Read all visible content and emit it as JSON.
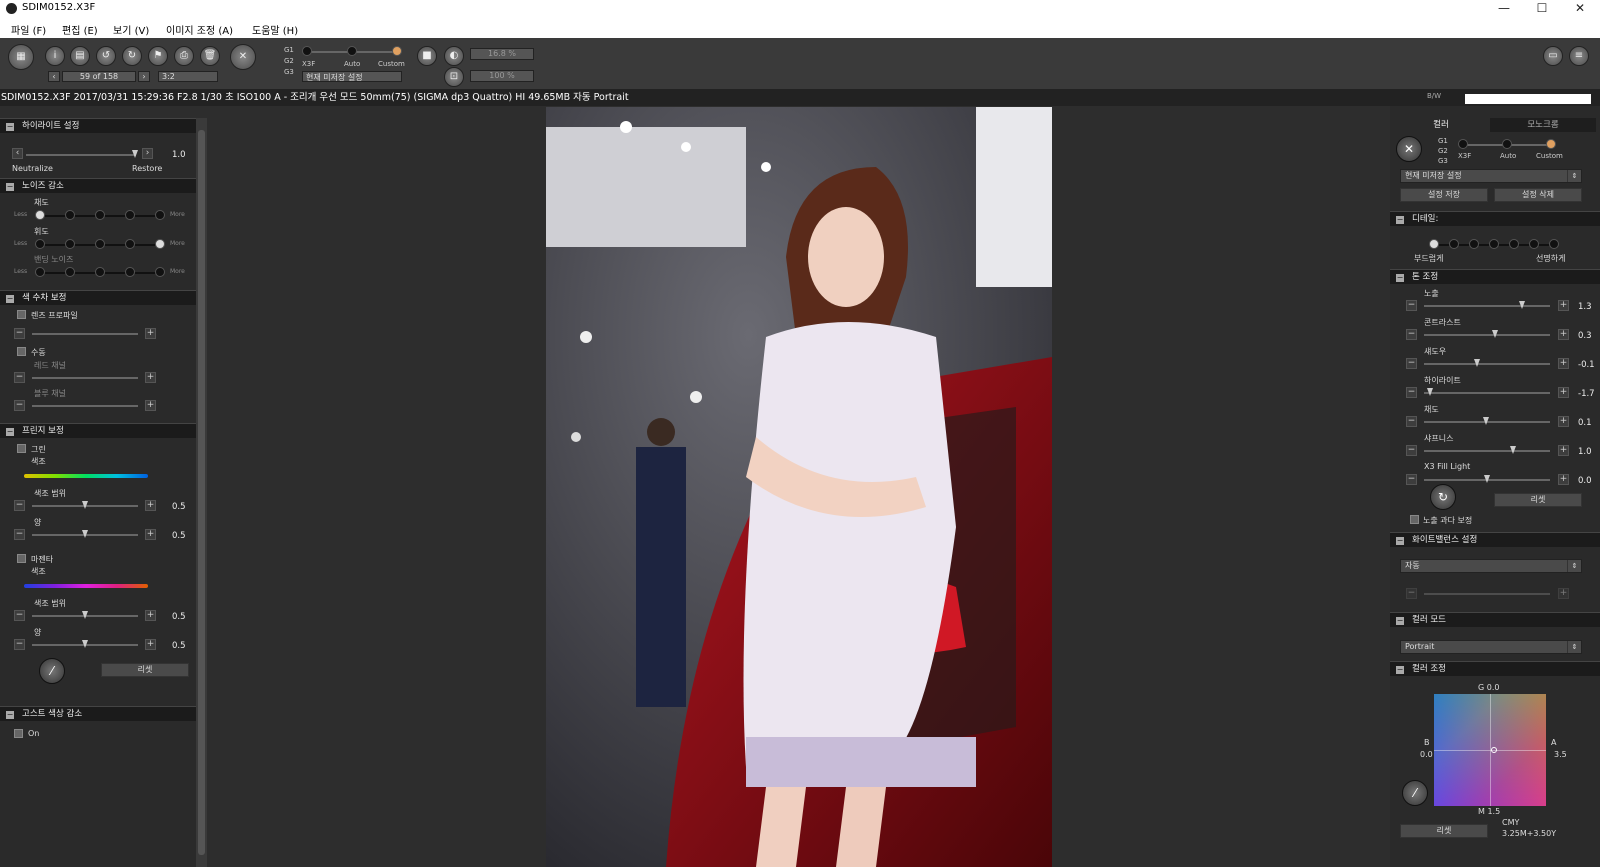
{
  "window": {
    "title": "SDIM0152.X3F",
    "logo_icon": "sigma-logo-icon",
    "minimize": "—",
    "maximize": "☐",
    "close": "✕"
  },
  "menu": [
    "파일 (F)",
    "편집 (E)",
    "보기 (V)",
    "이미지 조정 (A)",
    "도움말 (H)"
  ],
  "toolbar": {
    "counter": "59 of 158",
    "ratio": "3:2",
    "groups": [
      "G1",
      "G2",
      "G3"
    ],
    "modes": [
      "X3F",
      "Auto",
      "Custom"
    ],
    "preset": "현재 미저장 설정",
    "zoom1": "16.8 %",
    "zoom2": "100 %",
    "icons": [
      "film-icon",
      "info-icon",
      "save-icon",
      "rotate-left-icon",
      "rotate-right-icon",
      "flag-icon",
      "print-icon",
      "delete-icon",
      "sigma-x-icon",
      "stop-icon",
      "crop-icon",
      "screen-icon",
      "menu-icon"
    ]
  },
  "infobar": "SDIM0152.X3F 2017/03/31 15:29:36 F2.8 1/30 초 ISO100 A - 조리개 우선 모드 50mm(75) (SIGMA dp3 Quattro) HI 49.65MB 자동 Portrait",
  "bw_label": "B/W",
  "left": {
    "highlight": {
      "title": "하이라이트 설정",
      "left": "Neutralize",
      "right": "Restore",
      "value": "1.0"
    },
    "noise": {
      "title": "노이즈 감소",
      "items": [
        "채도",
        "휘도",
        "밴딩 노이즈"
      ],
      "less": "Less",
      "more": "More"
    },
    "chroma": {
      "title": "색 수차 보정",
      "lens_profile": "렌즈 프로파일",
      "manual": "수동",
      "red": "레드 채널",
      "blue": "블루 채널"
    },
    "fringe": {
      "title": "프린지 보정",
      "green": "그린",
      "hue": "색조",
      "hue_range": "색조 범위",
      "amount": "양",
      "val1": "0.5",
      "val2": "0.5",
      "magenta": "마젠타",
      "val3": "0.5",
      "val4": "0.5",
      "reset": "리셋"
    },
    "ghost": {
      "title": "고스트 색상 감소",
      "on": "On"
    }
  },
  "right": {
    "tabs": [
      "컬러",
      "모노크롬"
    ],
    "groups": [
      "G1",
      "G2",
      "G3"
    ],
    "modes": [
      "X3F",
      "Auto",
      "Custom"
    ],
    "preset": "현재 미저장 설정",
    "save": "설정 저장",
    "delete": "설정 삭제",
    "detail": {
      "title": "디테일:",
      "soft": "부드럽게",
      "sharp": "선명하게"
    },
    "tone": {
      "title": "톤 조정",
      "items": [
        {
          "label": "노출",
          "value": "1.3"
        },
        {
          "label": "콘트라스트",
          "value": "0.3"
        },
        {
          "label": "섀도우",
          "value": "-0.1"
        },
        {
          "label": "하이라이트",
          "value": "-1.7"
        },
        {
          "label": "채도",
          "value": "0.1"
        },
        {
          "label": "샤프니스",
          "value": "1.0"
        },
        {
          "label": "X3 Fill Light",
          "value": "0.0"
        }
      ],
      "reset": "리셋",
      "overexposure": "노출 과다 보정"
    },
    "wb": {
      "title": "화이트밸런스 설정",
      "value": "자동"
    },
    "colormode": {
      "title": "컬러 모드",
      "value": "Portrait"
    },
    "coloradj": {
      "title": "컬러 조정",
      "g": "G 0.0",
      "b": "B",
      "bval": "0.0",
      "a": "A",
      "aval": "3.5",
      "m": "M 1.5",
      "reset": "리셋",
      "cmy": "CMY",
      "cmyval": "3.25M+3.50Y"
    }
  }
}
